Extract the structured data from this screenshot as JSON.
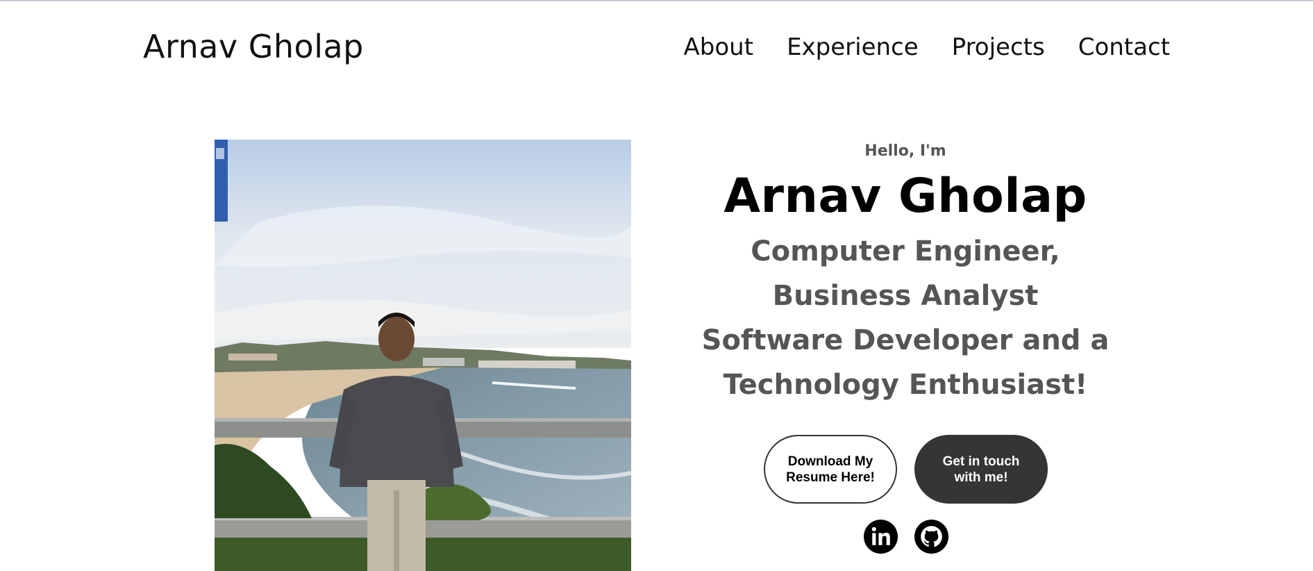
{
  "nav": {
    "logo": "Arnav Gholap",
    "links": [
      {
        "label": "About"
      },
      {
        "label": "Experience"
      },
      {
        "label": "Projects"
      },
      {
        "label": "Contact"
      }
    ]
  },
  "hero": {
    "greeting": "Hello, I'm",
    "name": "Arnav Gholap",
    "subtitle_lines": [
      "Computer Engineer,",
      "Business Analyst",
      "Software Developer and a",
      "Technology Enthusiast!"
    ],
    "buttons": {
      "resume": "Download My Resume Here!",
      "contact": "Get in touch with me!"
    },
    "socials": [
      {
        "icon": "linkedin-icon"
      },
      {
        "icon": "github-icon"
      }
    ]
  },
  "colors": {
    "text_primary": "#000000",
    "text_secondary": "#555555",
    "button_dark": "#353535"
  }
}
